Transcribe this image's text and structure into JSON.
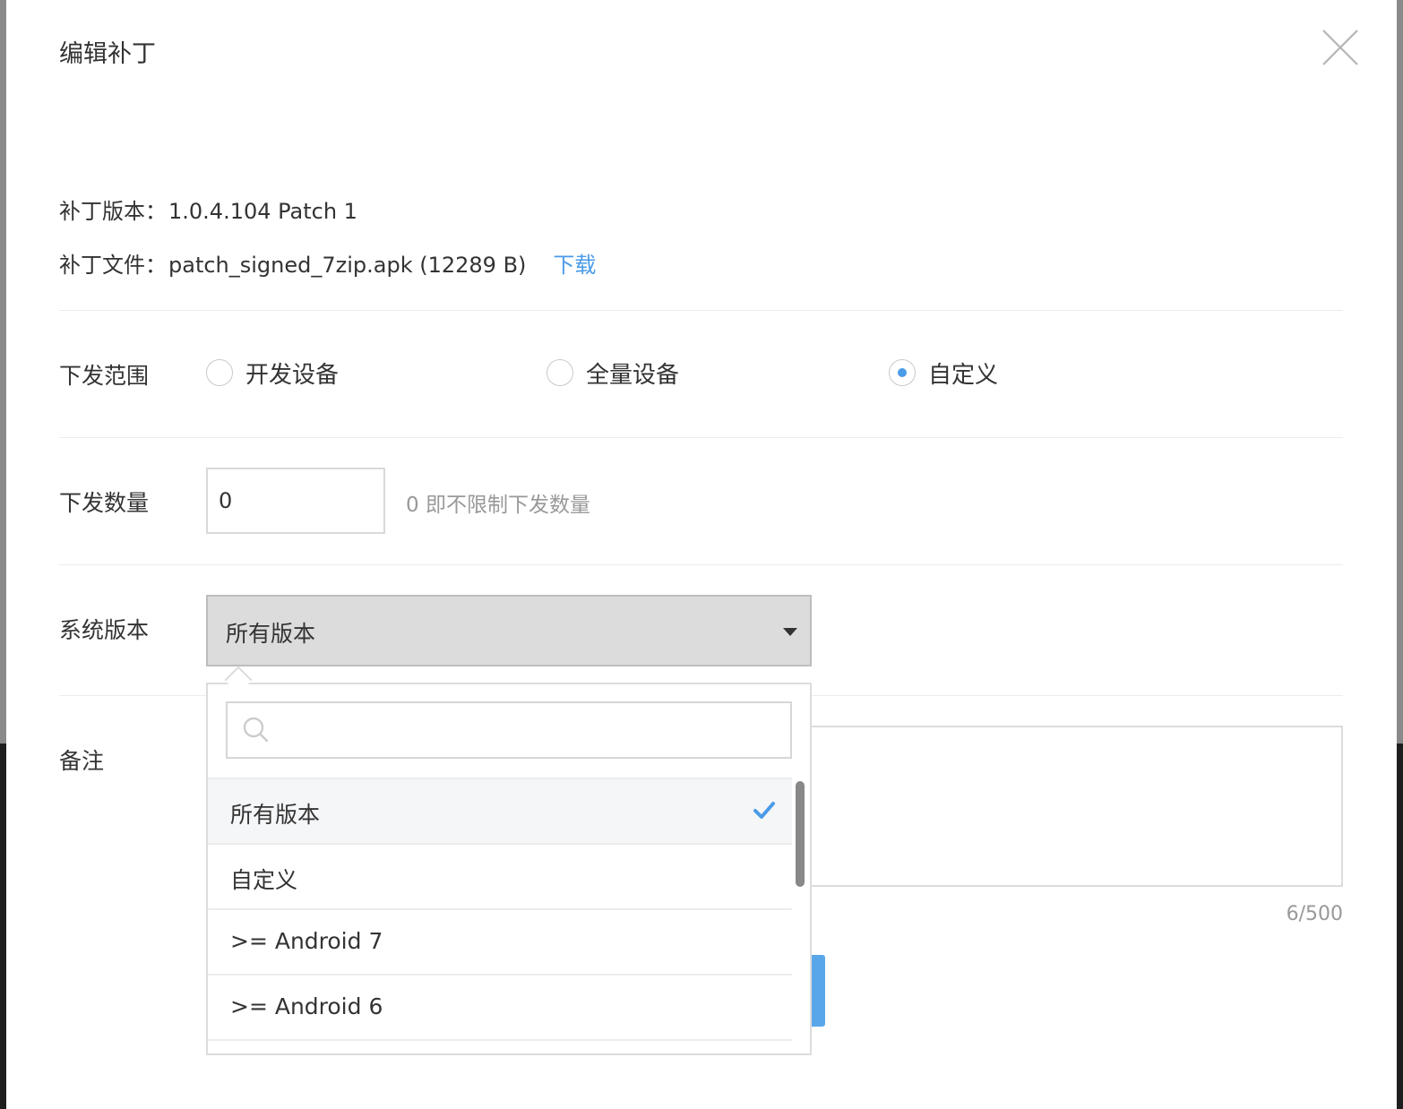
{
  "dialog": {
    "title": "编辑补丁"
  },
  "patch": {
    "version_label": "补丁版本：",
    "version_value": "1.0.4.104 Patch 1",
    "file_label": "补丁文件：",
    "file_value": "patch_signed_7zip.apk (12289 B)",
    "download_label": "下载"
  },
  "scope": {
    "label": "下发范围",
    "options": [
      {
        "label": "开发设备",
        "checked": false
      },
      {
        "label": "全量设备",
        "checked": false
      },
      {
        "label": "自定义",
        "checked": true
      }
    ]
  },
  "quantity": {
    "label": "下发数量",
    "value": "0",
    "hint": "0 即不限制下发数量"
  },
  "system_version": {
    "label": "系统版本",
    "selected": "所有版本",
    "search_placeholder": "",
    "options": [
      {
        "label": "所有版本",
        "selected": true
      },
      {
        "label": "自定义",
        "selected": false
      },
      {
        "label": ">= Android 7",
        "selected": false
      },
      {
        "label": ">= Android 6",
        "selected": false
      }
    ]
  },
  "remark": {
    "label": "备注",
    "count": "6/500"
  },
  "colors": {
    "accent": "#4a9be8",
    "text": "#333333",
    "muted": "#999999",
    "select_bg": "#dcdcdc"
  },
  "icons": {
    "close": "close-icon",
    "search": "search-icon",
    "check": "check-icon",
    "caret": "caret-down-icon"
  }
}
